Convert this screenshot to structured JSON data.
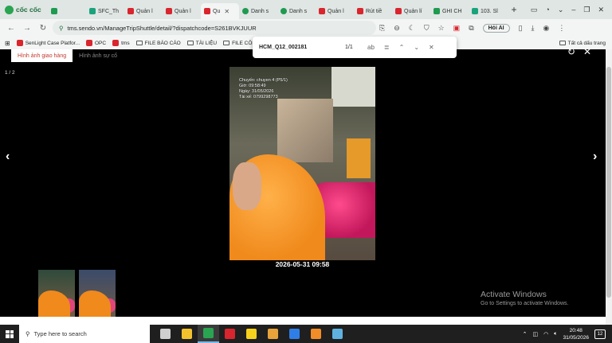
{
  "browser": {
    "brand": "cốc cốc",
    "tabs": [
      {
        "label": "",
        "favicon": "green"
      },
      {
        "label": "SFC_Th",
        "favicon": "teal"
      },
      {
        "label": "Quản l",
        "favicon": "red"
      },
      {
        "label": "Quản l",
        "favicon": "red"
      },
      {
        "label": "Qu",
        "favicon": "red",
        "active": true
      },
      {
        "label": "Danh s",
        "favicon": "green-r"
      },
      {
        "label": "Danh s",
        "favicon": "green-r"
      },
      {
        "label": "Quản l",
        "favicon": "red"
      },
      {
        "label": "Rút tiề",
        "favicon": "red"
      },
      {
        "label": "Quản lí",
        "favicon": "red"
      },
      {
        "label": "GHI CH",
        "favicon": "green"
      },
      {
        "label": "103. Sl",
        "favicon": "teal"
      }
    ],
    "url": "tms.sendo.vn/ManageTripShuttle/detail/?dispatchcode=S261BVKJUUR",
    "hoi_ai": "Hỏi AI",
    "bookmarks": [
      {
        "label": "SenLight Case Platfor...",
        "type": "favicon"
      },
      {
        "label": "OPC",
        "type": "favicon"
      },
      {
        "label": "tms",
        "type": "favicon"
      },
      {
        "label": "FILE BÁO CÁO",
        "type": "folder"
      },
      {
        "label": "TÀI LIỆU",
        "type": "folder"
      },
      {
        "label": "FILE CÔN",
        "type": "folder"
      }
    ],
    "all_bookmarks": "Tất cả dấu trang"
  },
  "findbar": {
    "query": "HCM_Q12_002181",
    "count": "1/1",
    "match_case_label": "ab"
  },
  "viewer": {
    "tabs": [
      "Hình ảnh giao hàng",
      "Hình ảnh sự cố"
    ],
    "counter": "1 / 2",
    "photo_overlay": [
      "Chuyến: chuyen 4 (P5/1)",
      "Giờ: 09:58:49",
      "Ngày: 31/05/2026",
      "Tài xế: 0799298773"
    ],
    "timestamp": "2026-05-31 09:58"
  },
  "watermark": {
    "title": "Activate Windows",
    "subtitle": "Go to Settings to activate Windows."
  },
  "taskbar": {
    "search_placeholder": "Type here to search",
    "time": "20:48",
    "date": "31/05/2026",
    "notification_count": "12",
    "apps": [
      {
        "name": "task-view",
        "color": "#cfcfcf"
      },
      {
        "name": "file-explorer",
        "color": "#f2c12e"
      },
      {
        "name": "coccoc",
        "color": "#2aa451",
        "active": true
      },
      {
        "name": "wps",
        "color": "#d9252d"
      },
      {
        "name": "sticky-notes",
        "color": "#f7d21c"
      },
      {
        "name": "chrome",
        "color": "#e8a33a"
      },
      {
        "name": "zalo",
        "color": "#2f7ee8"
      },
      {
        "name": "app-orange",
        "color": "#f28c28"
      },
      {
        "name": "app-blue",
        "color": "#5fb2e0"
      }
    ]
  },
  "colors": {
    "accent_red": "#c0392b",
    "tab_bar": "#dfe6e4",
    "taskbar": "#1f1f1f"
  }
}
